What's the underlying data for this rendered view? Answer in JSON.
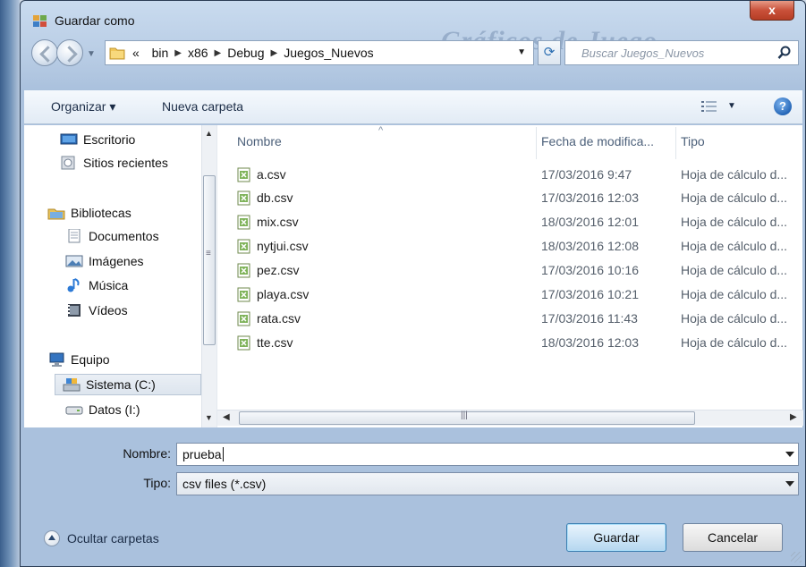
{
  "window": {
    "title": "Guardar como",
    "watermark": "Gráficos de Juego",
    "close_label": "x"
  },
  "nav": {
    "breadcrumb_prefix": "«",
    "breadcrumb": [
      "bin",
      "x86",
      "Debug",
      "Juegos_Nuevos"
    ],
    "search_placeholder": "Buscar Juegos_Nuevos"
  },
  "toolbar": {
    "organize_label": "Organizar ▾",
    "new_folder_label": "Nueva carpeta",
    "help_label": "?"
  },
  "sidebar": {
    "items": [
      {
        "label": "Escritorio",
        "icon": "desktop-icon"
      },
      {
        "label": "Sitios recientes",
        "icon": "recent-places-icon"
      },
      {
        "label": "Bibliotecas",
        "icon": "libraries-icon"
      },
      {
        "label": "Documentos",
        "icon": "documents-icon"
      },
      {
        "label": "Imágenes",
        "icon": "pictures-icon"
      },
      {
        "label": "Música",
        "icon": "music-icon"
      },
      {
        "label": "Vídeos",
        "icon": "videos-icon"
      },
      {
        "label": "Equipo",
        "icon": "computer-icon"
      },
      {
        "label": "Sistema (C:)",
        "icon": "drive-c-icon",
        "selected": true
      },
      {
        "label": "Datos (I:)",
        "icon": "drive-i-icon"
      }
    ]
  },
  "filelist": {
    "columns": {
      "name": "Nombre",
      "date": "Fecha de modifica...",
      "type": "Tipo"
    },
    "files": [
      {
        "name": "a.csv",
        "date": "17/03/2016 9:47",
        "type": "Hoja de cálculo d..."
      },
      {
        "name": "db.csv",
        "date": "17/03/2016 12:03",
        "type": "Hoja de cálculo d..."
      },
      {
        "name": "mix.csv",
        "date": "18/03/2016 12:01",
        "type": "Hoja de cálculo d..."
      },
      {
        "name": "nytjui.csv",
        "date": "18/03/2016 12:08",
        "type": "Hoja de cálculo d..."
      },
      {
        "name": "pez.csv",
        "date": "17/03/2016 10:16",
        "type": "Hoja de cálculo d..."
      },
      {
        "name": "playa.csv",
        "date": "17/03/2016 10:21",
        "type": "Hoja de cálculo d..."
      },
      {
        "name": "rata.csv",
        "date": "17/03/2016 11:43",
        "type": "Hoja de cálculo d..."
      },
      {
        "name": "tte.csv",
        "date": "18/03/2016 12:03",
        "type": "Hoja de cálculo d..."
      }
    ]
  },
  "form": {
    "name_label": "Nombre:",
    "name_value": "prueba",
    "type_label": "Tipo:",
    "type_value": "csv files (*.csv)"
  },
  "footer": {
    "hide_folders_label": "Ocultar carpetas",
    "save_label": "Guardar",
    "cancel_label": "Cancelar"
  },
  "colors": {
    "accent": "#3c7fb1",
    "close": "#c9513a",
    "window_bg": "#b9cde5"
  }
}
